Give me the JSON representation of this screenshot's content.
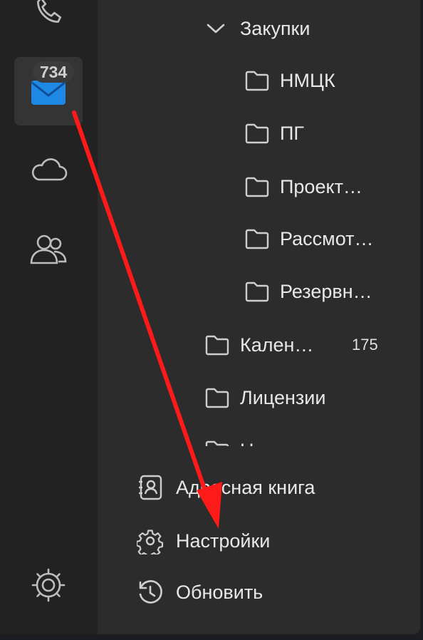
{
  "rail": {
    "items": [
      {
        "icon": "phone-icon"
      },
      {
        "icon": "mail-icon",
        "badge": "734",
        "active": true
      },
      {
        "icon": "cloud-icon"
      },
      {
        "icon": "contacts-icon"
      }
    ],
    "bottom_icon": "settings-gear-icon"
  },
  "folders": {
    "parent": {
      "label": "Закупки",
      "expanded": true
    },
    "children": [
      {
        "label": "НМЦК"
      },
      {
        "label": "ПГ"
      },
      {
        "label": "Проект…"
      },
      {
        "label": "Рассмот…"
      },
      {
        "label": "Резервн…"
      }
    ],
    "siblings": [
      {
        "label": "Кален…",
        "count": "175"
      },
      {
        "label": "Лицензии"
      },
      {
        "label": "Новиков"
      }
    ]
  },
  "actions": {
    "address_book": "Адресная книга",
    "settings": "Настройки",
    "refresh": "Обновить"
  },
  "annotation": {
    "color": "#ff1a1a"
  },
  "colors": {
    "accent": "#1e88e5",
    "rail_bg": "#222222",
    "panel_bg": "#2c2c2c"
  }
}
